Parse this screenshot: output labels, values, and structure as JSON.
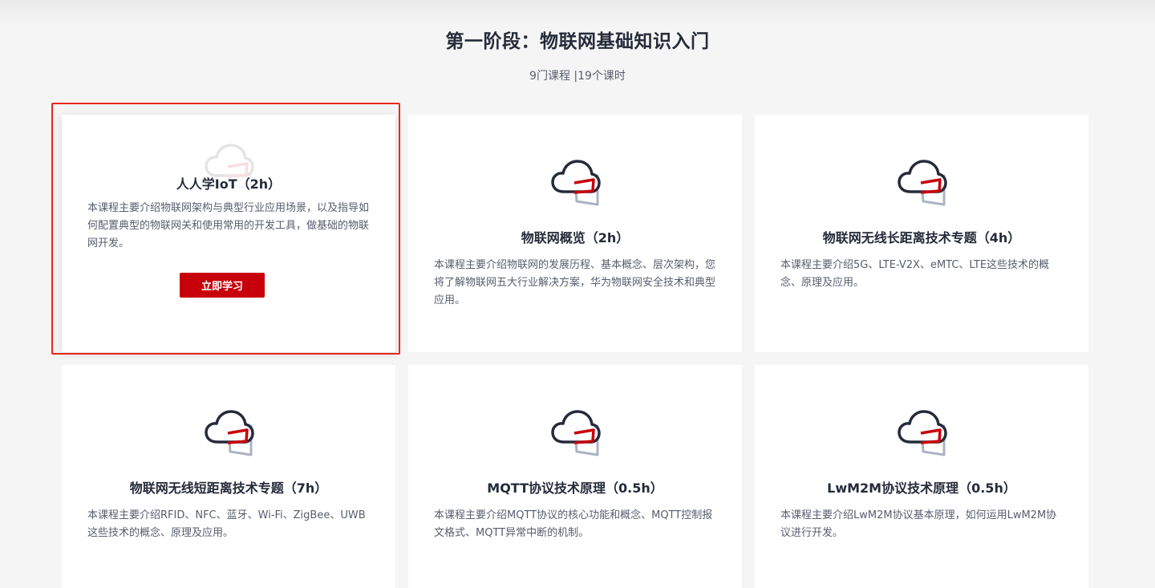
{
  "stage": {
    "title": "第一阶段：物联网基础知识入门",
    "summary": "9门课程 |19个课时"
  },
  "colors": {
    "accent": "#c7000b",
    "highlight_border": "#e8281c",
    "title_text": "#252b3a",
    "body_text": "#575d6c",
    "cloud_outline": "#252b3a",
    "panel_outline": "#aab4c2"
  },
  "course_icon": "cloud-iot-icon",
  "courses": [
    {
      "title": "人人学IoT（2h）",
      "desc": "本课程主要介绍物联网架构与典型行业应用场景，以及指导如何配置典型的物联网关和使用常用的开发工具，做基础的物联网开发。",
      "button": "立即学习",
      "highlighted": true
    },
    {
      "title": "物联网概览（2h）",
      "desc": "本课程主要介绍物联网的发展历程、基本概念、层次架构，您将了解物联网五大行业解决方案，华为物联网安全技术和典型应用。"
    },
    {
      "title": "物联网无线长距离技术专题（4h）",
      "desc": "本课程主要介绍5G、LTE-V2X、eMTC、LTE这些技术的概念、原理及应用。"
    },
    {
      "title": "物联网无线短距离技术专题（7h）",
      "desc": "本课程主要介绍RFID、NFC、蓝牙、Wi-Fi、ZigBee、UWB这些技术的概念、原理及应用。"
    },
    {
      "title": "MQTT协议技术原理（0.5h）",
      "desc": "本课程主要介绍MQTT协议的核心功能和概念、MQTT控制报文格式、MQTT异常中断的机制。"
    },
    {
      "title": "LwM2M协议技术原理（0.5h）",
      "desc": "本课程主要介绍LwM2M协议基本原理，如何运用LwM2M协议进行开发。"
    }
  ]
}
